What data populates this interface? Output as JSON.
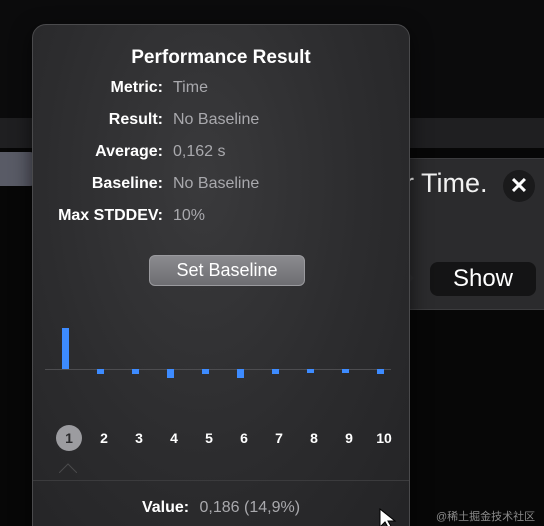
{
  "background": {
    "message_text": "r Time.",
    "show_label": "Show",
    "close_symbol": "✕"
  },
  "performance": {
    "title": "Performance Result",
    "rows": [
      {
        "label": "Metric:",
        "value": "Time"
      },
      {
        "label": "Result:",
        "value": "No Baseline"
      },
      {
        "label": "Average:",
        "value": "0,162 s"
      },
      {
        "label": "Baseline:",
        "value": "No Baseline"
      },
      {
        "label": "Max STDDEV:",
        "value": "10%"
      }
    ],
    "set_baseline_label": "Set Baseline",
    "selected_iteration": 1,
    "footer_label": "Value:",
    "footer_value": "0,186 (14,9%)"
  },
  "chart_data": {
    "type": "bar",
    "categories": [
      "1",
      "2",
      "3",
      "4",
      "5",
      "6",
      "7",
      "8",
      "9",
      "10"
    ],
    "values": [
      0.186,
      0.159,
      0.159,
      0.157,
      0.159,
      0.157,
      0.159,
      0.16,
      0.161,
      0.159
    ],
    "baseline_value": 0.162,
    "bar_color": "#3d8bff"
  },
  "watermark": "@稀土掘金技术社区",
  "colors": {
    "accent": "#3d8bff",
    "popover_bg": "#2c2c2e",
    "label_text": "#ffffff",
    "value_text": "#a9a9ad"
  }
}
